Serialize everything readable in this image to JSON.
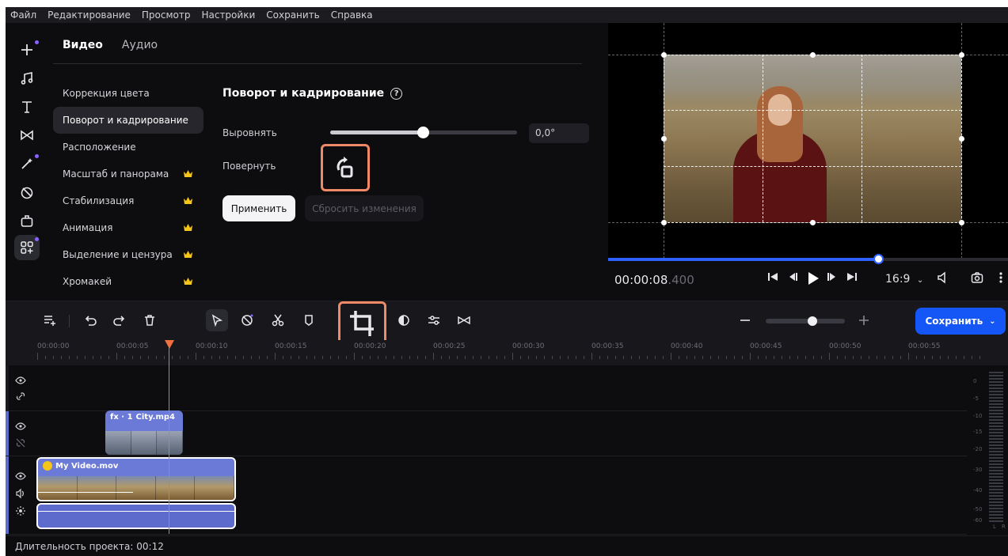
{
  "menu": [
    "Файл",
    "Редактирование",
    "Просмотр",
    "Настройки",
    "Сохранить",
    "Справка"
  ],
  "rail_icons": [
    "add-media-icon",
    "music-icon",
    "text-icon",
    "transitions-icon",
    "effects-icon",
    "stickers-icon",
    "filters-icon",
    "more-tools-icon"
  ],
  "tabs": {
    "video": "Видео",
    "audio": "Аудио"
  },
  "categories": [
    {
      "label": "Коррекция цвета",
      "premium": false
    },
    {
      "label": "Поворот и кадрирование",
      "premium": false
    },
    {
      "label": "Расположение",
      "premium": false
    },
    {
      "label": "Масштаб и панорама",
      "premium": true
    },
    {
      "label": "Стабилизация",
      "premium": true
    },
    {
      "label": "Анимация",
      "premium": true
    },
    {
      "label": "Выделение и цензура",
      "premium": true
    },
    {
      "label": "Хромакей",
      "premium": true
    }
  ],
  "rotate_crop": {
    "title": "Поворот и кадрирование",
    "align_label": "Выровнять",
    "align_value": "0,0°",
    "align_level": 0.5,
    "rotate_label": "Повернуть",
    "apply": "Применить",
    "reset": "Сбросить изменения"
  },
  "player": {
    "time_main": "00:00:08",
    "time_frac": ".400",
    "progress": 0.675,
    "ratio": "16:9"
  },
  "toolbar": {
    "save": "Сохранить",
    "zoom_level": 0.6
  },
  "ruler": [
    "00:00:00",
    "00:00:05",
    "00:00:10",
    "00:00:15",
    "00:00:20",
    "00:00:25",
    "00:00:30",
    "00:00:35",
    "00:00:40",
    "00:00:45",
    "00:00:50",
    "00:00:55"
  ],
  "clips": {
    "city": {
      "fx": "fx · 1",
      "name": "City.mp4"
    },
    "my_video": {
      "name": "My Video.mov"
    }
  },
  "meter_labels": [
    "0",
    "-5",
    "-10",
    "-15",
    "-20",
    "-30",
    "-40",
    "-50",
    "-60"
  ],
  "meter_channels": [
    "L",
    "R"
  ],
  "footer": {
    "duration": "Длительность проекта: 00:12"
  },
  "colors": {
    "accent": "#1556f6",
    "highlight": "#f08967",
    "clip": "#6c7ad7",
    "playhead": "#f0713f",
    "premium": "#f5c518"
  }
}
